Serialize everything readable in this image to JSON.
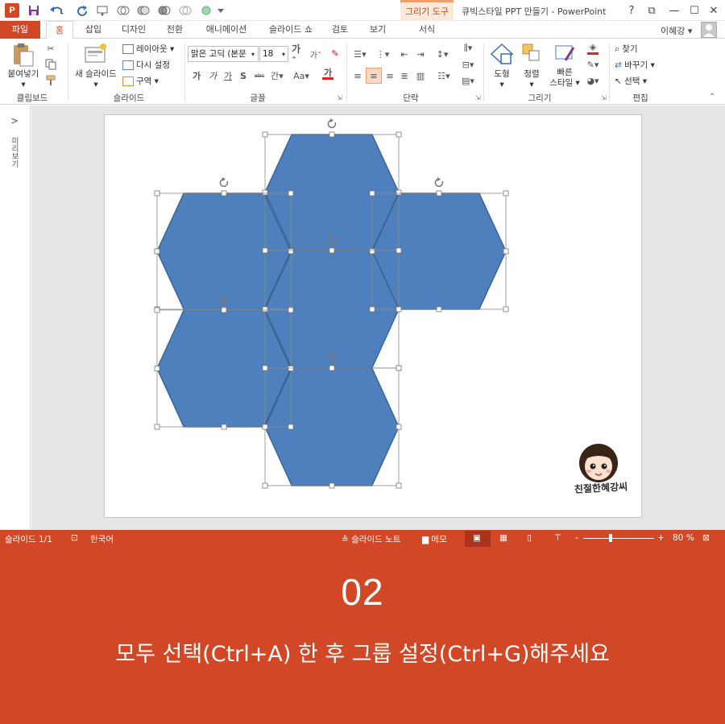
{
  "app": {
    "icon_letter": "P",
    "window_title": "큐빅스타일 PPT 만들기 - PowerPoint",
    "context_tab_group": "그리기 도구",
    "window_buttons": [
      "?",
      "⧉",
      "—",
      "☐",
      "✕"
    ]
  },
  "tabs": [
    "파일",
    "홈",
    "삽입",
    "디자인",
    "전환",
    "애니메이션",
    "슬라이드 쇼",
    "검토",
    "보기",
    "서식"
  ],
  "active_tab": "홈",
  "user": {
    "name": "이혜강"
  },
  "ribbon": {
    "clipboard": {
      "label": "클립보드",
      "paste": "붙여넣기"
    },
    "slides": {
      "label": "슬라이드",
      "new_slide": "새 슬라이드",
      "layout": "레이아웃",
      "reset": "다시 설정",
      "section": "구역"
    },
    "font": {
      "label": "글꼴",
      "font_name": "맑은 고딕 (본문",
      "font_size": "18",
      "format_buttons": [
        "가",
        "가",
        "가",
        "S",
        "abc",
        "간",
        "Aa",
        "가"
      ]
    },
    "paragraph": {
      "label": "단락"
    },
    "drawing": {
      "label": "그리기",
      "shapes": "도형",
      "arrange": "정렬",
      "quick_styles_1": "빠른",
      "quick_styles_2": "스타일"
    },
    "editing": {
      "label": "편집",
      "find": "찾기",
      "replace": "바꾸기",
      "select": "선택"
    }
  },
  "left_pane": {
    "label": "미리보기",
    "expand": ">"
  },
  "slide": {
    "hexagon_fill": "#4e80bd",
    "hexagon_stroke": "#3a6595",
    "hexagon_count": 6,
    "logo_text": "친절한혜강씨"
  },
  "statusbar": {
    "slide_info": "슬라이드 1/1",
    "language": "한국어",
    "notes": "슬라이드 노트",
    "comments": "메모",
    "zoom_text": "80 %",
    "zoom_percent": 80
  },
  "banner": {
    "step": "02",
    "caption": "모두 선택(Ctrl+A) 한 후 그룹 설정(Ctrl+G)해주세요"
  },
  "colors": {
    "accent": "#d24726",
    "context_tab": "#fde9d9"
  }
}
